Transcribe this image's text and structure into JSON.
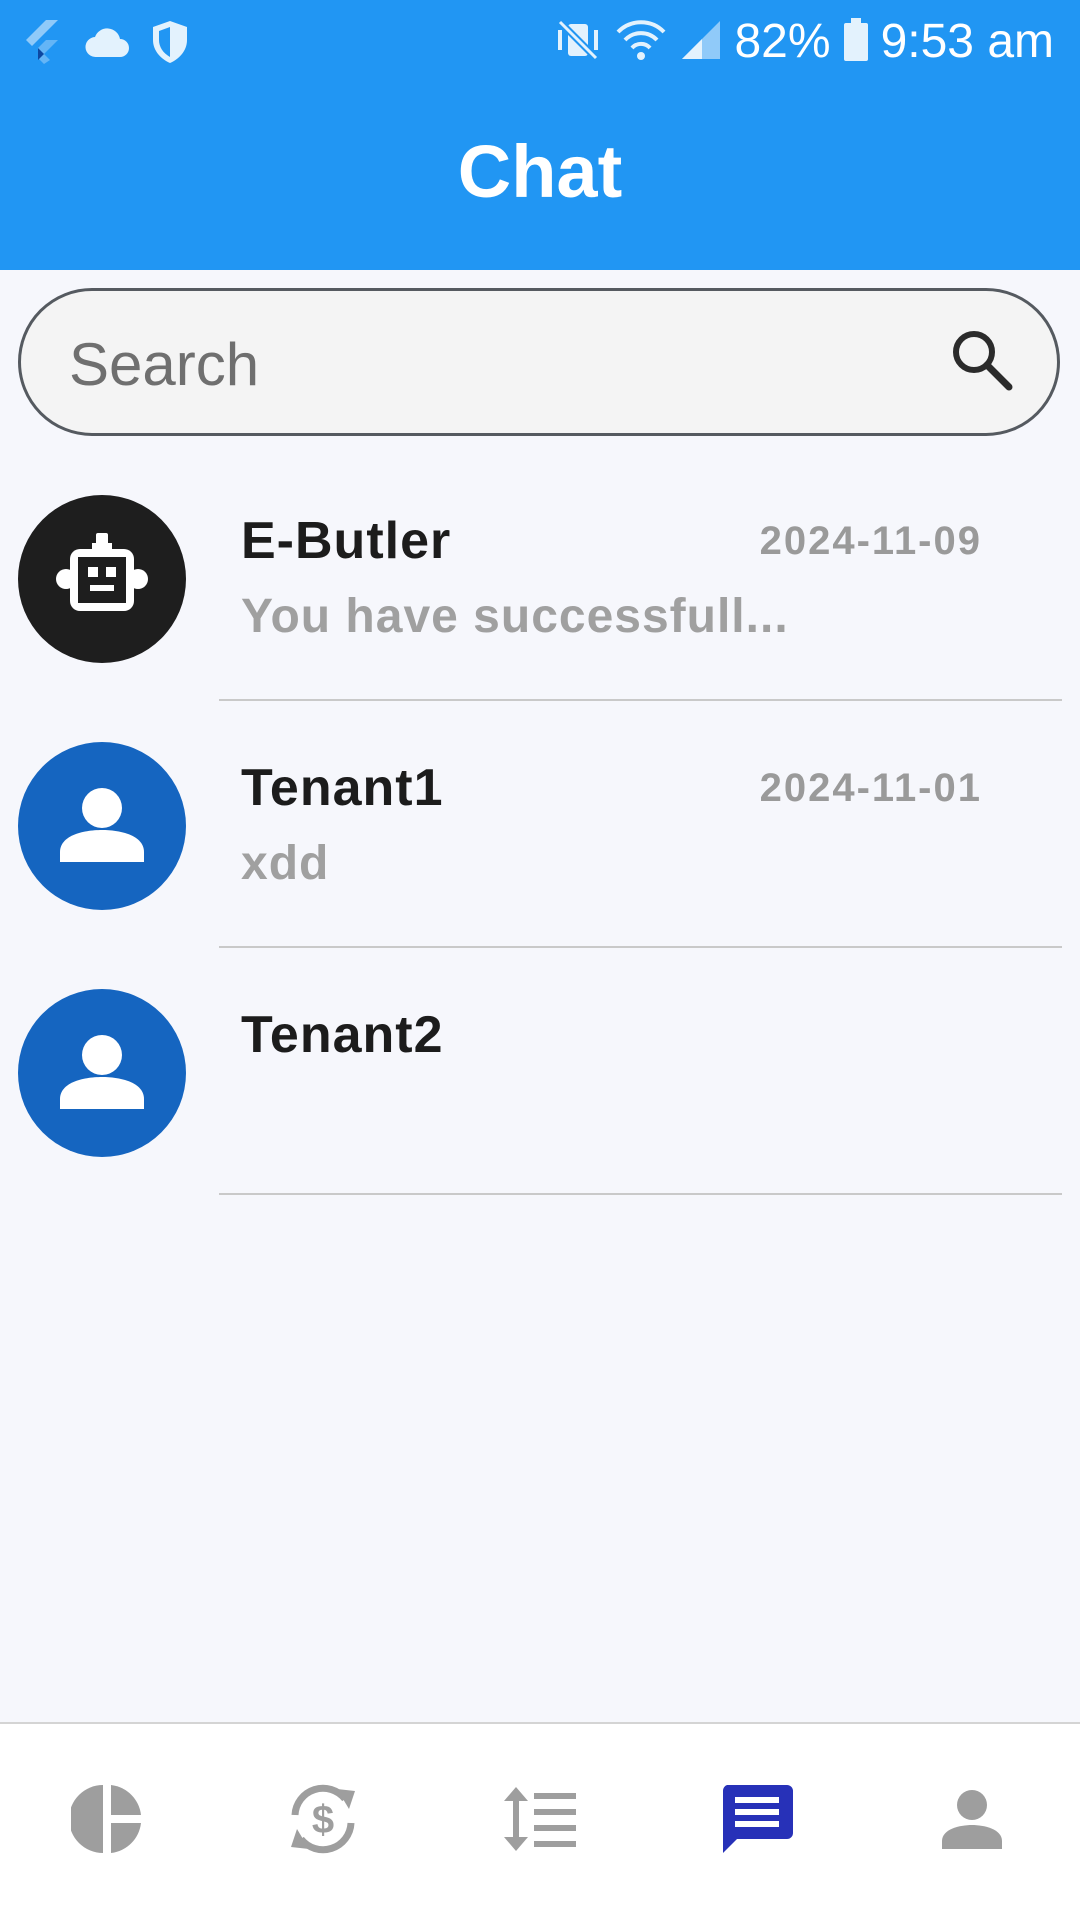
{
  "status_bar": {
    "battery": "82%",
    "time": "9:53 am"
  },
  "app_bar": {
    "title": "Chat"
  },
  "search": {
    "placeholder": "Search"
  },
  "chats": [
    {
      "name": "E-Butler",
      "date": "2024-11-09",
      "preview": "You have successfull...",
      "avatar": "robot-icon"
    },
    {
      "name": "Tenant1",
      "date": "2024-11-01",
      "preview": "xdd",
      "avatar": "person-icon"
    },
    {
      "name": "Tenant2",
      "date": "",
      "preview": "",
      "avatar": "person-icon"
    }
  ],
  "bottom_nav": {
    "items": [
      {
        "icon": "pie-chart-icon",
        "active": false
      },
      {
        "icon": "currency-exchange-icon",
        "active": false
      },
      {
        "icon": "sort-list-icon",
        "active": false
      },
      {
        "icon": "chat-icon",
        "active": true
      },
      {
        "icon": "person-icon",
        "active": false
      }
    ]
  },
  "colors": {
    "app_bar": "#2196f3",
    "avatar_user": "#1565c0",
    "avatar_bot": "#1e1e1e",
    "nav_active": "#2731b8",
    "nav_inactive": "#9e9e9e"
  }
}
